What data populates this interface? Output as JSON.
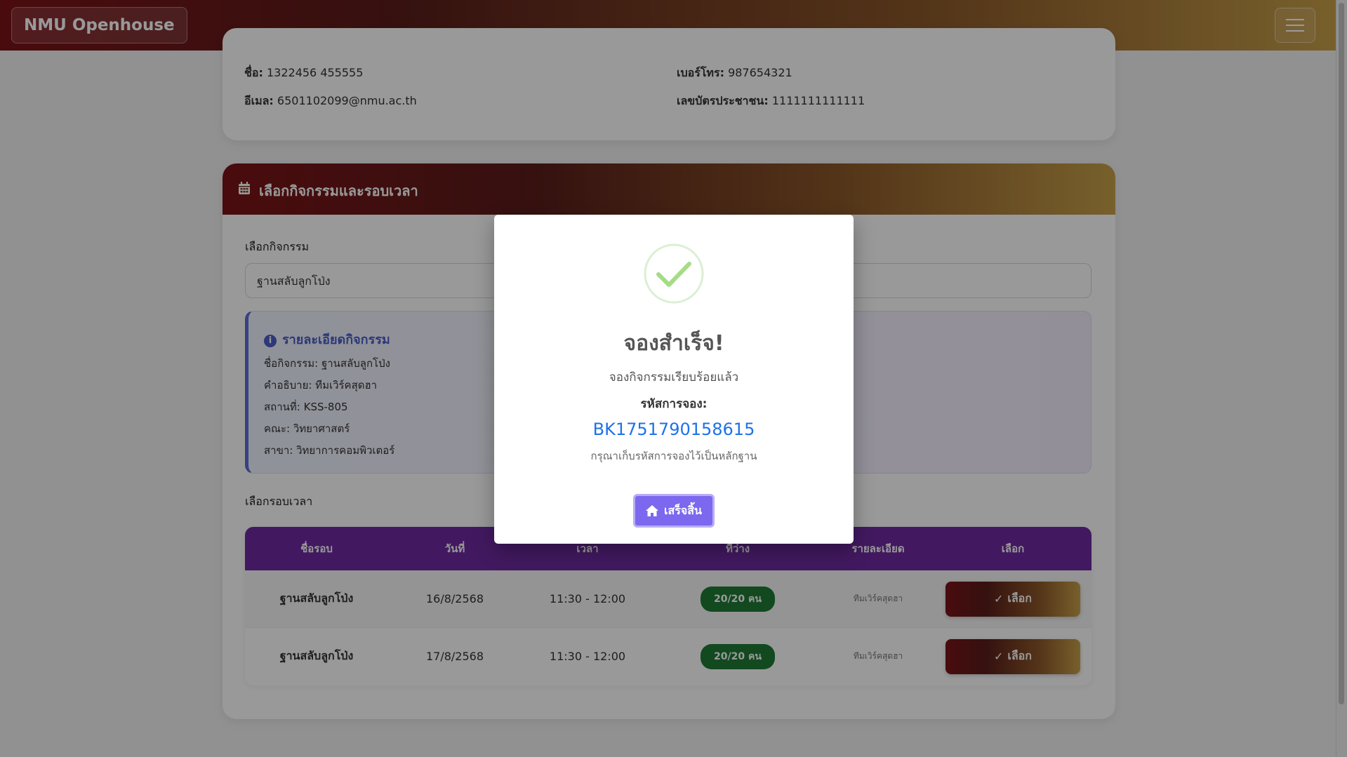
{
  "navbar": {
    "brand": "NMU Openhouse"
  },
  "user_info": {
    "name_label": "ชื่อ:",
    "name": "1322456 455555",
    "phone_label": "เบอร์โทร:",
    "phone": "987654321",
    "email_label": "อีเมล:",
    "email": "6501102099@nmu.ac.th",
    "id_label": "เลขบัตรประชาชน:",
    "id_number": "1111111111111"
  },
  "booking": {
    "header_title": "เลือกกิจกรรมและรอบเวลา",
    "activity_label": "เลือกกิจกรรม",
    "activity_selected": "ฐานสลับลูกโป่ง",
    "details": {
      "title": "รายละเอียดกิจกรรม",
      "name": "ชื่อกิจกรรม: ฐานสลับลูกโป่ง",
      "description": "คำอธิบาย: ทีมเวิร์คสุดฮา",
      "location": "สถานที่: KSS-805",
      "faculty": "คณะ: วิทยาศาสตร์",
      "major": "สาขา: วิทยาการคอมพิวเตอร์"
    },
    "slot_label": "เลือกรอบเวลา",
    "table": {
      "headers": [
        "ชื่อรอบ",
        "วันที่",
        "เวลา",
        "ที่ว่าง",
        "รายละเอียด",
        "เลือก"
      ],
      "rows": [
        {
          "name": "ฐานสลับลูกโป่ง",
          "date": "16/8/2568",
          "time": "11:30 - 12:00",
          "available": "20/20 คน",
          "detail": "ทีมเวิร์คสุดฮา",
          "button": "เลือก"
        },
        {
          "name": "ฐานสลับลูกโป่ง",
          "date": "17/8/2568",
          "time": "11:30 - 12:00",
          "available": "20/20 คน",
          "detail": "ทีมเวิร์คสุดฮา",
          "button": "เลือก"
        }
      ]
    }
  },
  "modal": {
    "title": "จองสำเร็จ!",
    "message": "จองกิจกรรมเรียบร้อยแล้ว",
    "code_label": "รหัสการจอง:",
    "code": "BK1751790158615",
    "note": "กรุณาเก็บรหัสการจองไว้เป็นหลักฐาน",
    "button": "เสร็จสิ้น"
  },
  "colors": {
    "brand_dark": "#7b1318",
    "brand_gold": "#c8a04a",
    "table_header": "#6f2aa0",
    "badge_green": "#1f7a35",
    "code_blue": "#1e72e8",
    "modal_button": "#7b68ee"
  }
}
